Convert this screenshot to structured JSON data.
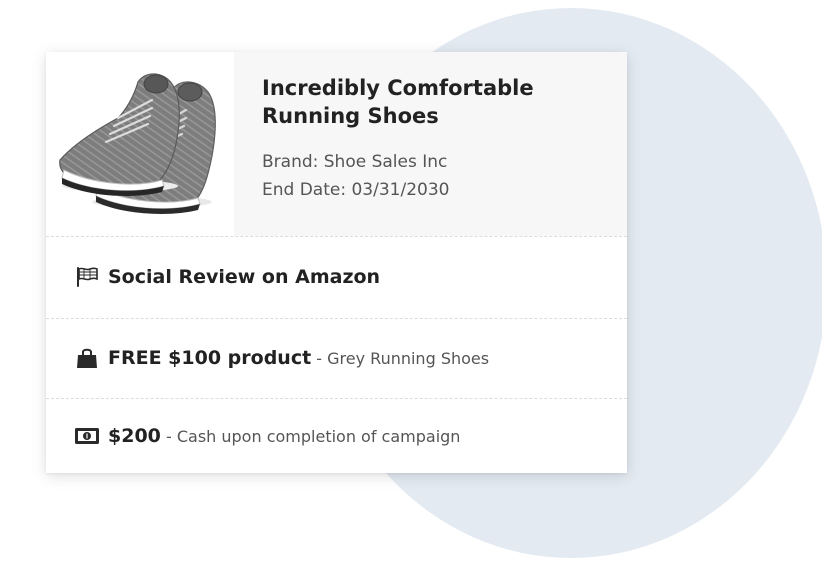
{
  "product": {
    "title": "Incredibly Comfortable Running Shoes",
    "brand": "Brand: Shoe Sales Inc",
    "end_date": "End Date: 03/31/2030",
    "image_icon": "running-shoes-photo"
  },
  "campaign": [
    {
      "icon": "flag-icon",
      "title": "Social Review on Amazon",
      "separator": "",
      "detail": ""
    },
    {
      "icon": "shopping-bag-icon",
      "title": "FREE $100 product",
      "separator": " - ",
      "detail": "Grey Running Shoes"
    },
    {
      "icon": "cash-icon",
      "title": "$200",
      "separator": " - ",
      "detail": "Cash upon completion of campaign"
    }
  ],
  "colors": {
    "background_circle": "#e3eaf2",
    "card": "#ffffff",
    "product_panel": "#f7f7f7",
    "title_text": "#222222",
    "muted_text": "#555555",
    "divider": "#dcdcdc"
  }
}
